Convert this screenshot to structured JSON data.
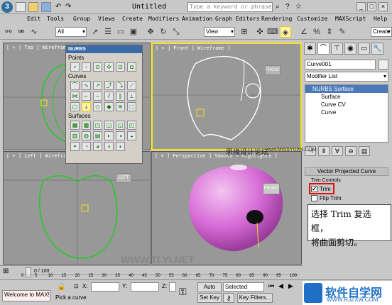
{
  "titlebar": {
    "app_icon": "3ds-max-logo",
    "logo_text": "3",
    "filename": "Untitled",
    "search_placeholder": "Type a keyword or phrase"
  },
  "menu": [
    "Edit",
    "Tools",
    "Group",
    "Views",
    "Create",
    "Modifiers",
    "Animation",
    "Graph Editors",
    "Rendering",
    "Customize",
    "MAXScript",
    "Help"
  ],
  "toolbar": {
    "selection_filter": "All",
    "ref_coord": "View",
    "create_sel_set": "Create"
  },
  "viewports": {
    "top": "[ + ] Top ] Wireframe ]",
    "front": "[ + ] Front ] Wireframe ]",
    "left": "[ + ] Left ] Wireframe ]",
    "perspective": "[ + ] Perspective ] Smooth + Highlights ]"
  },
  "viewcube_labels": {
    "front": "FRONT",
    "left": "LEFT",
    "persp": "FRONT"
  },
  "nurbs_panel": {
    "title": "NURBS",
    "sections": {
      "points": "Points",
      "curves": "Curves",
      "surfaces": "Surfaces"
    }
  },
  "command_panel": {
    "object_name": "Curve001",
    "modifier_list": "Modifier List",
    "stack": {
      "root": "NURBS Surface",
      "items": [
        "Surface",
        "Curve CV",
        "Curve"
      ]
    },
    "rollout_title": "Vector Projected Curve",
    "group_label": "Trim Controls",
    "trim_label": "Trim",
    "trim_checked": true,
    "flip_trim_label": "Flip Trim"
  },
  "callout_text": [
    "选择 Trim 复选框，",
    "将曲面剪切。"
  ],
  "timeline": {
    "frame": "0 / 100",
    "ticks": [
      "0",
      "5",
      "10",
      "15",
      "20",
      "25",
      "30",
      "35",
      "40",
      "45",
      "50",
      "55",
      "60",
      "65",
      "70",
      "75",
      "80",
      "85",
      "90",
      "95",
      "100"
    ]
  },
  "status": {
    "maxscript": "Welcome to MAX!",
    "prompt": "Pick a curve",
    "x_label": "X:",
    "y_label": "Y:",
    "z_label": "Z:",
    "auto_key": "Auto Key",
    "selected": "Selected",
    "set_key": "Set Key",
    "key_filters": "Key Filters..."
  },
  "watermarks": {
    "forum": "思缘设计论坛",
    "site1": "www.MISSYUAN.COM",
    "site2": "WWW.TLYI.NET",
    "brand_cn": "软件自学网",
    "brand_url": "WWW.RJZXW.COM"
  },
  "colors": {
    "active_border": "#f3e21c",
    "spline_green": "#19d019",
    "apple_pink": "#d66ad6",
    "highlight_red": "#e01010"
  }
}
